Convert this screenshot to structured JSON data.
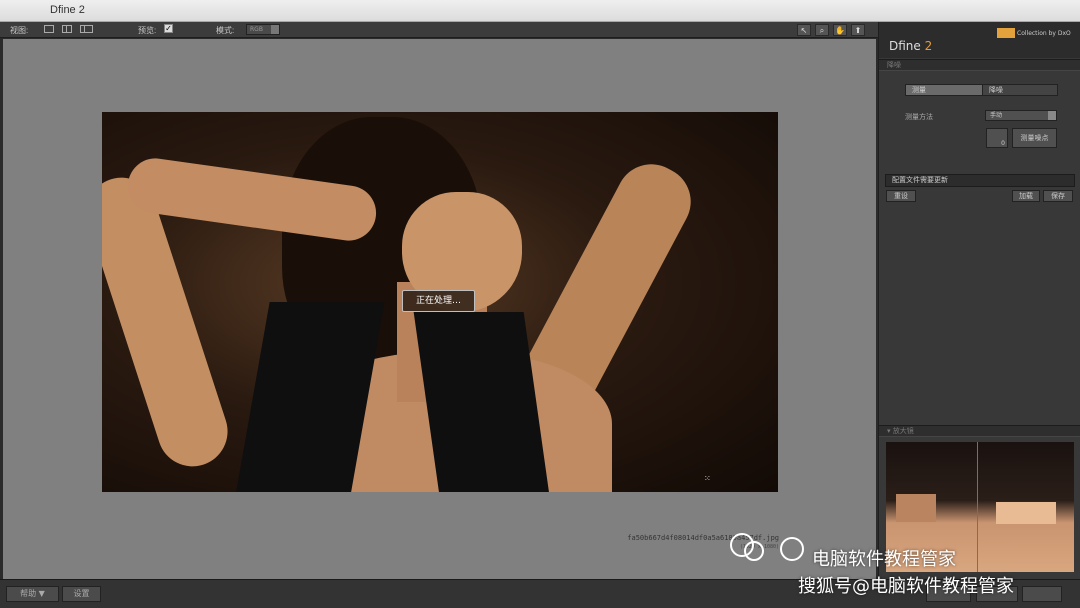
{
  "window": {
    "title": "Dfine 2"
  },
  "toolbar": {
    "view_label": "视图:",
    "preview_label": "预览:",
    "preview_checked": "✓",
    "mode_label": "模式:",
    "mode_value": "RGB"
  },
  "canvas": {
    "processing_text": "正在处理…",
    "filename": "fa50b667d4f08014df0a5a6180a457df.jpg",
    "dimensions": "(1920 x 1080)"
  },
  "panel": {
    "brand": "Dfine",
    "version": "2",
    "collection": "Collection by DxO",
    "section_noise": "降噪",
    "tab_measure": "测量",
    "tab_reduce": "降噪",
    "method_label": "测量方法",
    "method_value": "手动",
    "measure_count": "0",
    "measure_points_button": "测量噪点",
    "status_text": "配置文件需要更新",
    "reset_button": "重设",
    "load_button": "加载",
    "save_button": "保存",
    "loupe_label": "放大镜"
  },
  "bottombar": {
    "help_button": "帮助 ▼",
    "settings_button": "设置"
  },
  "watermark": {
    "line1": "电脑软件教程管家",
    "line2": "搜狐号@电脑软件教程管家"
  }
}
